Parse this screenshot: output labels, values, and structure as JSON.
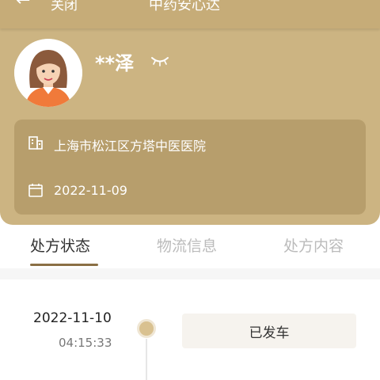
{
  "topbar": {
    "back_label": "关闭",
    "title": "中药安心达"
  },
  "user": {
    "name": "**泽"
  },
  "info": {
    "hospital": "上海市松江区方塔中医医院",
    "date": "2022-11-09"
  },
  "tabs": [
    {
      "label": "处方状态",
      "active": true
    },
    {
      "label": "物流信息",
      "active": false
    },
    {
      "label": "处方内容",
      "active": false
    }
  ],
  "timeline": [
    {
      "date": "2022-11-10",
      "time": "04:15:33",
      "status": "已发车"
    }
  ],
  "colors": {
    "header_bg": "#ccb482",
    "card_bg": "#b79e6c",
    "accent": "#8a6f44",
    "timeline_dot": "#d9c190"
  }
}
